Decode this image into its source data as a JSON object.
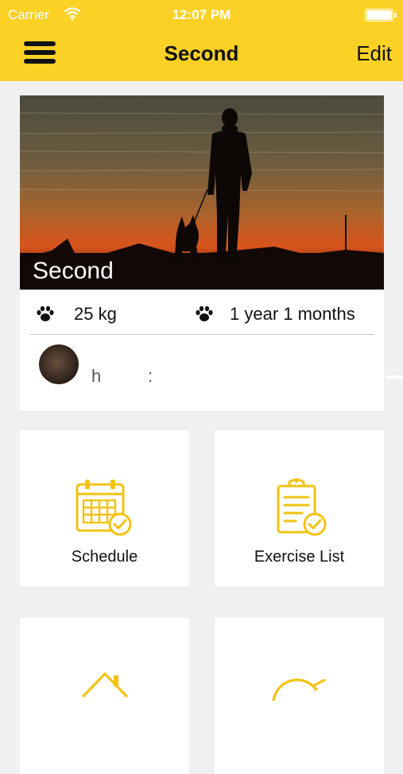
{
  "status_bar": {
    "carrier": "Carrier",
    "time": "12:07 PM"
  },
  "nav": {
    "title": "Second",
    "edit_label": "Edit"
  },
  "pet": {
    "name": "Second",
    "weight": "25 kg",
    "age": "1 year 1 months",
    "owner_name": "h       :"
  },
  "tiles": [
    {
      "label": "Schedule",
      "icon": "calendar-check-icon"
    },
    {
      "label": "Exercise List",
      "icon": "clipboard-check-icon"
    },
    {
      "label": "",
      "icon": "home-icon"
    },
    {
      "label": "",
      "icon": "timer-icon"
    }
  ],
  "colors": {
    "accent": "#fbd125",
    "icon_yellow": "#f2c314",
    "background": "#f0f0f0"
  }
}
